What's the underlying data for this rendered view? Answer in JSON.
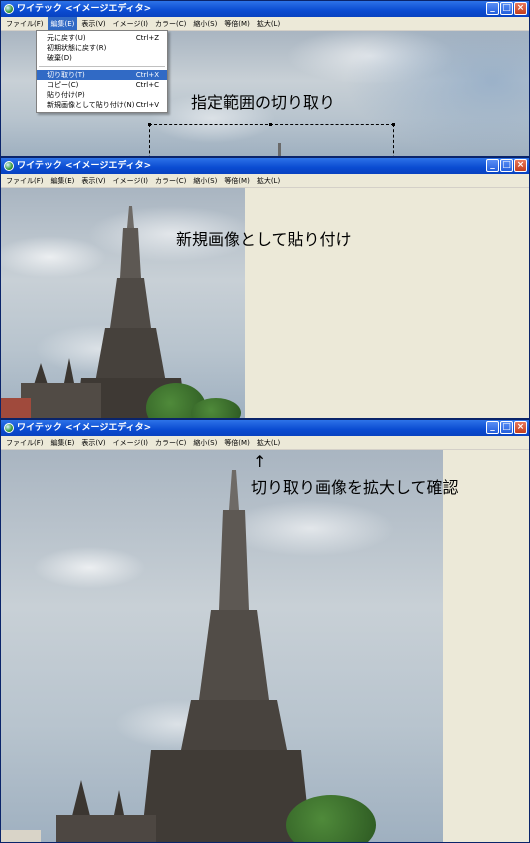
{
  "window_title": "ワイテック <イメージエディタ>",
  "title_buttons": [
    "_",
    "□",
    "×"
  ],
  "menu": [
    "ファイル(F)",
    "編集(E)",
    "表示(V)",
    "イメージ(I)",
    "カラー(C)",
    "縮小(S)",
    "等倍(M)",
    "拡大(L)"
  ],
  "edit_menu": {
    "items": [
      {
        "label": "元に戻す(U)",
        "shortcut": "Ctrl+Z"
      },
      {
        "label": "初期状態に戻す(R)",
        "shortcut": ""
      },
      {
        "label": "破棄(D)",
        "shortcut": ""
      },
      {
        "label": "切り取り(T)",
        "shortcut": "Ctrl+X"
      },
      {
        "label": "コピー(C)",
        "shortcut": "Ctrl+C"
      },
      {
        "label": "貼り付け(P)",
        "shortcut": ""
      },
      {
        "label": "新規画像として貼り付け(N)",
        "shortcut": "Ctrl+V"
      }
    ]
  },
  "captions": {
    "step1": "指定範囲の切り取り",
    "step2": "新規画像として貼り付け",
    "arrow": "↑",
    "step3": "切り取り画像を拡大して確認"
  },
  "colors": {
    "titlebar": "#0a4bd1",
    "menu_highlight": "#316ac5",
    "workspace": "#ece9d8"
  }
}
